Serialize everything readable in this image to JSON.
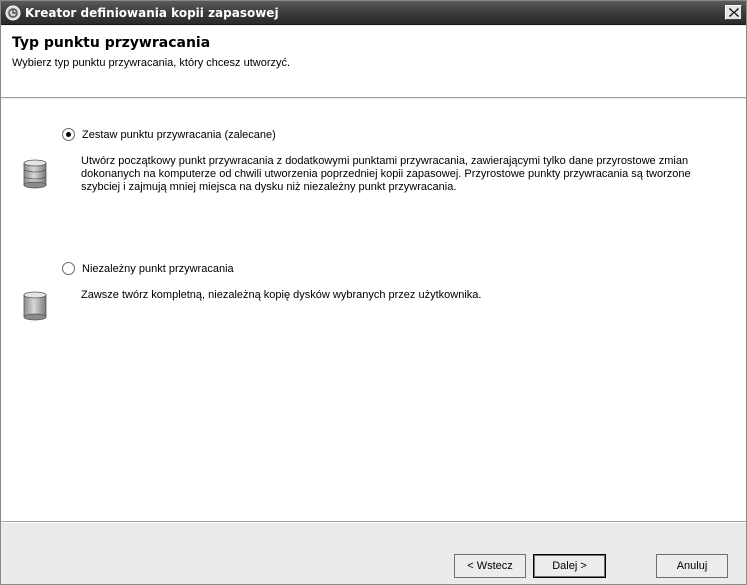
{
  "window": {
    "title": "Kreator definiowania kopii zapasowej",
    "close_label": "×"
  },
  "header": {
    "title": "Typ punktu przywracania",
    "subtitle": "Wybierz typ punktu przywracania, który chcesz utworzyć."
  },
  "options": [
    {
      "label": "Zestaw punktu przywracania (zalecane)",
      "checked": true,
      "description": "Utwórz początkowy punkt przywracania z dodatkowymi punktami przywracania, zawierającymi tylko dane przyrostowe zmian dokonanych na komputerze od chwili utworzenia poprzedniej kopii zapasowej. Przyrostowe punkty przywracania są tworzone szybciej i zajmują mniej miejsca na dysku niż niezależny punkt przywracania.",
      "icon": "database-stack-icon"
    },
    {
      "label": "Niezależny punkt przywracania",
      "checked": false,
      "description": "Zawsze twórz kompletną, niezależną kopię dysków wybranych przez użytkownika.",
      "icon": "database-icon"
    }
  ],
  "buttons": {
    "back": "< Wstecz",
    "next": "Dalej >",
    "cancel": "Anuluj"
  }
}
